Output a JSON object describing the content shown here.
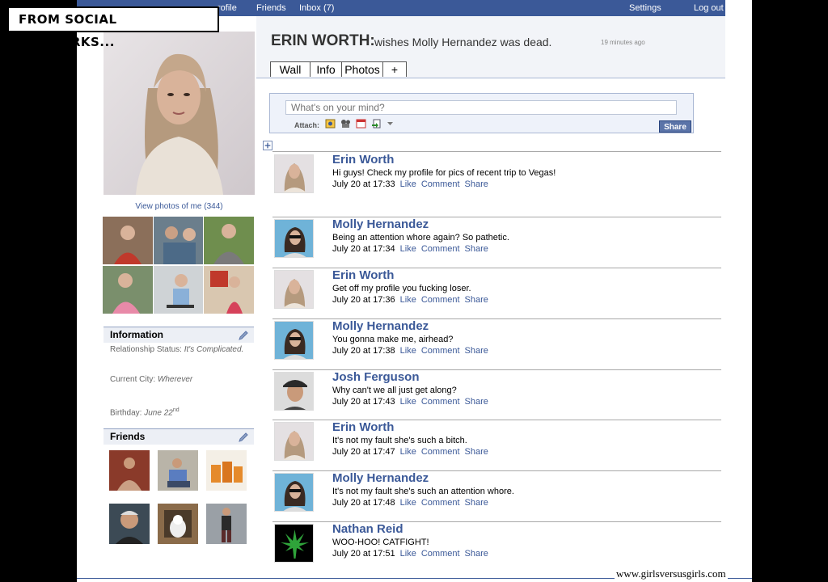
{
  "caption": "FROM SOCIAL NETWORKS...",
  "topbar": {
    "profile_fragment": "rofile",
    "friends": "Friends",
    "inbox": "Inbox (7)",
    "settings": "Settings",
    "logout": "Log out"
  },
  "profile": {
    "name": "ERIN WORTH:",
    "status": "wishes Molly Hernandez was dead.",
    "status_time": "19 minutes ago"
  },
  "tabs": [
    "Wall",
    "Info",
    "Photos",
    "+"
  ],
  "composer": {
    "placeholder": "What's on your mind?",
    "attach_label": "Attach:",
    "share_label": "Share"
  },
  "sidebar": {
    "view_photos": "View photos of me (344)",
    "information_title": "Information",
    "relationship_label": "Relationship Status:",
    "relationship_value": "It's Complicated.",
    "city_label": "Current City:",
    "city_value": "Wherever",
    "birthday_label": "Birthday:",
    "birthday_value": "June 22",
    "birthday_suffix": "nd",
    "friends_title": "Friends"
  },
  "feed_actions": {
    "like": "Like",
    "comment": "Comment",
    "share": "Share"
  },
  "feed": [
    {
      "name": "Erin Worth",
      "message": "Hi guys! Check my profile for pics of recent trip to Vegas!",
      "time": "July 20 at 17:33",
      "avatar": "erin"
    },
    {
      "name": "Molly Hernandez",
      "message": "Being an attention whore again? So pathetic.",
      "time": "July 20 at 17:34",
      "avatar": "molly"
    },
    {
      "name": "Erin Worth",
      "message": "Get off my profile you fucking loser.",
      "time": "July 20 at 17:36",
      "avatar": "erin"
    },
    {
      "name": "Molly Hernandez",
      "message": "You gonna make me, airhead?",
      "time": "July 20 at 17:38",
      "avatar": "molly"
    },
    {
      "name": "Josh Ferguson",
      "message": "Why can't we all just get along?",
      "time": "July 20 at 17:43",
      "avatar": "josh"
    },
    {
      "name": "Erin Worth",
      "message": "It's not my fault she's such a bitch.",
      "time": "July 20 at 17:47",
      "avatar": "erin"
    },
    {
      "name": "Molly Hernandez",
      "message": "It's not my fault she's such an attention whore.",
      "time": "July 20 at 17:48",
      "avatar": "molly"
    },
    {
      "name": "Nathan Reid",
      "message": "WOO-HOO! CATFIGHT!",
      "time": "July 20 at 17:51",
      "avatar": "nathan"
    }
  ],
  "watermark": "www.girlsversusgirls.com",
  "colors": {
    "brand": "#3b5998",
    "link": "#3b5998",
    "header_bg": "#f2f4f8",
    "caption_border": "#000000"
  }
}
